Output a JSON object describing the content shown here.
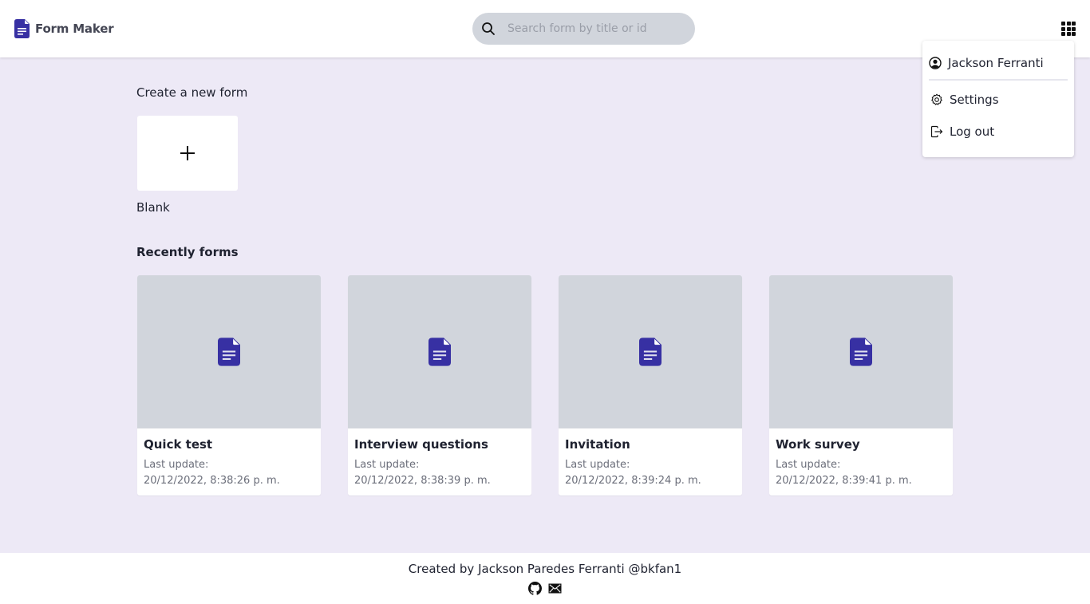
{
  "header": {
    "brand_name": "Form Maker",
    "brand_color": "#3730a3",
    "search_placeholder": "Search form by title or id",
    "search_value": ""
  },
  "user_menu": {
    "user_name": "Jackson Ferranti",
    "items": [
      {
        "label": "Settings",
        "icon": "gear-icon"
      },
      {
        "label": "Log out",
        "icon": "logout-icon"
      }
    ]
  },
  "create_section": {
    "title": "Create a new form",
    "blank_label": "Blank"
  },
  "recent_section": {
    "title": "Recently forms",
    "forms": [
      {
        "title": "Quick test",
        "updated_label": "Last update:",
        "updated_at": "20/12/2022, 8:38:26 p. m."
      },
      {
        "title": "Interview questions",
        "updated_label": "Last update:",
        "updated_at": "20/12/2022, 8:38:39 p. m."
      },
      {
        "title": "Invitation",
        "updated_label": "Last update:",
        "updated_at": "20/12/2022, 8:39:24 p. m."
      },
      {
        "title": "Work survey",
        "updated_label": "Last update:",
        "updated_at": "20/12/2022, 8:39:41 p. m."
      }
    ]
  },
  "footer": {
    "credit": "Created by Jackson Paredes Ferranti @bkfan1",
    "links": [
      "github-icon",
      "mail-icon"
    ]
  }
}
